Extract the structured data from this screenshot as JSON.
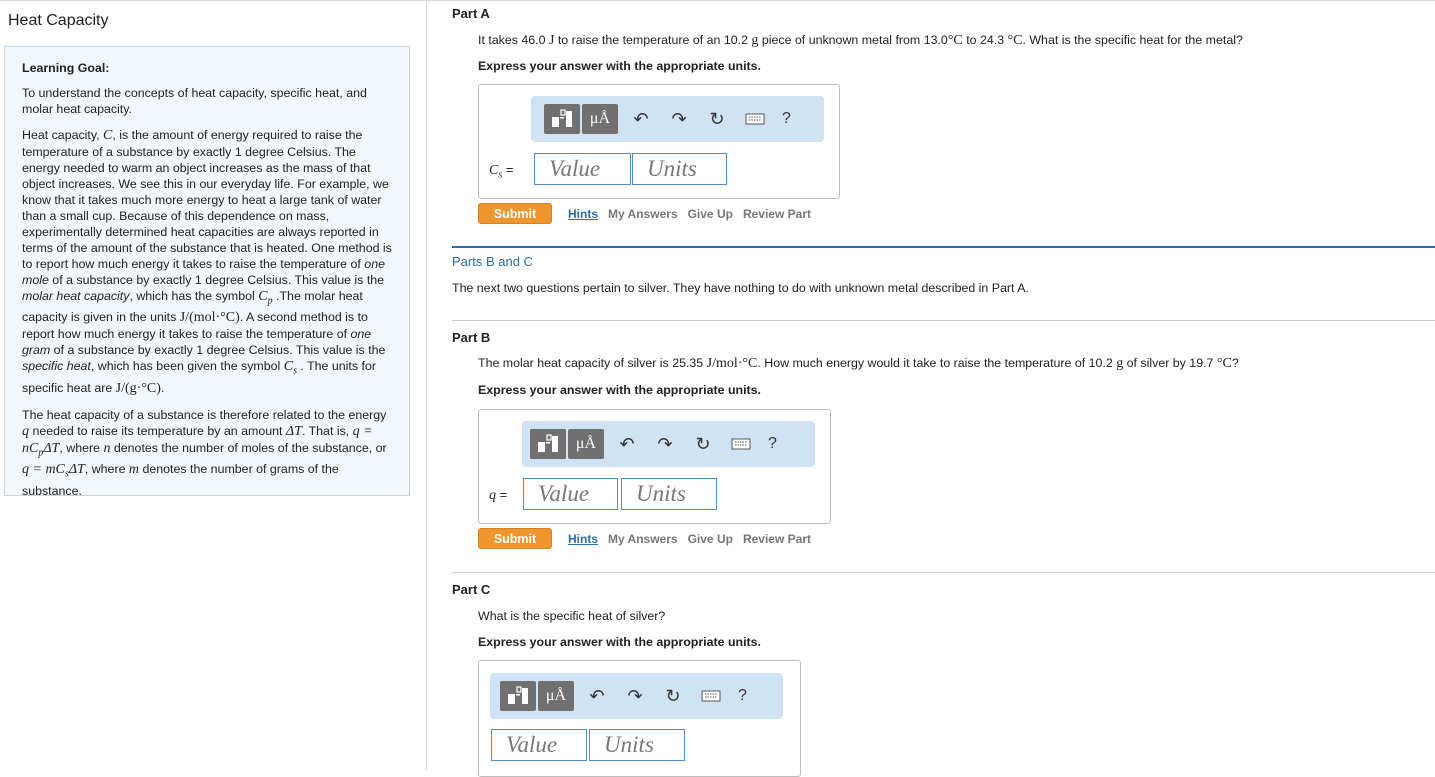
{
  "title": "Heat Capacity",
  "learning_goal": {
    "heading": "Learning Goal:",
    "intro": "To understand the concepts of heat capacity, specific heat, and molar heat capacity.",
    "p1_a": "Heat capacity, ",
    "p1_C": "C",
    "p1_b": ", is the amount of energy required to raise the temperature of a substance by exactly 1 degree Celsius. The energy needed to warm an object increases as the mass of that object increases. We see this in our everyday life. For example, we know that it takes much more energy to heat a large tank of water than a small cup. Because of this dependence on mass, experimentally determined heat capacities are always reported in terms of the amount of the substance that is heated. One method is to report how much energy it takes to raise the temperature of ",
    "p1_em1": "one mole",
    "p1_c": " of a substance by exactly 1 degree Celsius. This value is the ",
    "p1_em2": "molar heat capacity",
    "p1_d": ", which has the symbol ",
    "p1_Cp": "C",
    "p1_Cp_sub": "p",
    "p1_e": " .The molar heat capacity is given in the units ",
    "p1_unit1": "J/(mol·°C)",
    "p1_f": ". A second method is to report how much energy it takes to raise the temperature of ",
    "p1_em3": "one gram",
    "p1_g": " of a substance by exactly 1 degree Celsius. This value is the ",
    "p1_em4": "specific heat",
    "p1_h": ", which has been given the symbol ",
    "p1_Cs": "C",
    "p1_Cs_sub": "s",
    "p1_i": " . The units for specific heat are ",
    "p1_unit2": "J/(g·°C)",
    "p1_j": ".",
    "p2_a": "The heat capacity of a substance is therefore related to the energy ",
    "p2_q": "q",
    "p2_b": " needed to raise its temperature by an amount ",
    "p2_dT": "ΔT",
    "p2_c": ". That is, ",
    "p2_eq1": "q = nC",
    "p2_eq1_sub": "p",
    "p2_eq1_end": "ΔT",
    "p2_d": ", where ",
    "p2_n": "n",
    "p2_e": " denotes the number of moles of the substance, or ",
    "p2_eq2": "q = mC",
    "p2_eq2_sub": "s",
    "p2_eq2_end": "ΔT",
    "p2_f": ", where ",
    "p2_m": "m",
    "p2_g": " denotes the number of grams of the substance."
  },
  "toolbar": {
    "mu_label": "μÅ",
    "help_label": "?"
  },
  "actions": {
    "submit": "Submit",
    "hints": "Hints",
    "my_answers": "My Answers",
    "give_up": "Give Up",
    "review_part": "Review Part"
  },
  "placeholders": {
    "value": "Value",
    "units": "Units"
  },
  "part_a": {
    "title": "Part A",
    "question_a": "It takes 46.0 ",
    "question_J": "J",
    "question_b": " to raise the temperature of an 10.2 ",
    "question_g": "g",
    "question_c": " piece of unknown metal from 13.0",
    "question_deg1": "°C",
    "question_d": " to 24.3 ",
    "question_deg2": "°C",
    "question_e": ". What is the specific heat for the metal?",
    "instruction": "Express your answer with the appropriate units.",
    "var_label": "C",
    "var_sub": "s",
    "var_eq": " ="
  },
  "parts_bc": {
    "title": "Parts B and C",
    "text": "The next two questions pertain to silver. They have nothing to do with unknown metal described in Part A."
  },
  "part_b": {
    "title": "Part B",
    "question_a": "The molar heat capacity of silver is 25.35 ",
    "question_unit": "J/mol·°C",
    "question_b": ". How much energy would it take to raise the temperature of 10.2 ",
    "question_g": "g",
    "question_c": " of silver by 19.7 ",
    "question_deg": "°C",
    "question_d": "?",
    "instruction": "Express your answer with the appropriate units.",
    "var_label": "q",
    "var_eq": " ="
  },
  "part_c": {
    "title": "Part C",
    "question": "What is the specific heat of silver?",
    "instruction": "Express your answer with the appropriate units."
  }
}
